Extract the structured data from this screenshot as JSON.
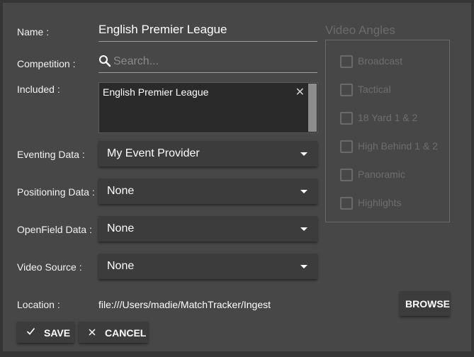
{
  "form": {
    "name_label": "Name :",
    "name_value": "English Premier League",
    "competition_label": "Competition :",
    "search_placeholder": "Search...",
    "included_label": "Included :",
    "included_items": [
      "English Premier League"
    ],
    "included_remove_glyph": "✕",
    "eventing_label": "Eventing Data :",
    "eventing_value": "My Event Provider",
    "positioning_label": "Positioning Data :",
    "positioning_value": "None",
    "openfield_label": "OpenField Data :",
    "openfield_value": "None",
    "video_source_label": "Video Source :",
    "video_source_value": "None",
    "location_label": "Location :",
    "location_value": "file:///Users/madie/MatchTracker/Ingest"
  },
  "video_angles": {
    "title": "Video Angles",
    "options": [
      {
        "label": "Broadcast",
        "checked": false
      },
      {
        "label": "Tactical",
        "checked": false
      },
      {
        "label": "18 Yard 1 & 2",
        "checked": false
      },
      {
        "label": "High Behind 1 & 2",
        "checked": false
      },
      {
        "label": "Panoramic",
        "checked": false
      },
      {
        "label": "Highlights",
        "checked": false
      }
    ]
  },
  "buttons": {
    "browse": "BROWSE",
    "save": "SAVE",
    "save_icon": "check-icon",
    "cancel": "CANCEL",
    "cancel_icon": "close-icon"
  },
  "colors": {
    "background": "#474747",
    "outer": "#353535",
    "control": "#3c3c3c",
    "disabled_text": "#6e6e6e"
  }
}
